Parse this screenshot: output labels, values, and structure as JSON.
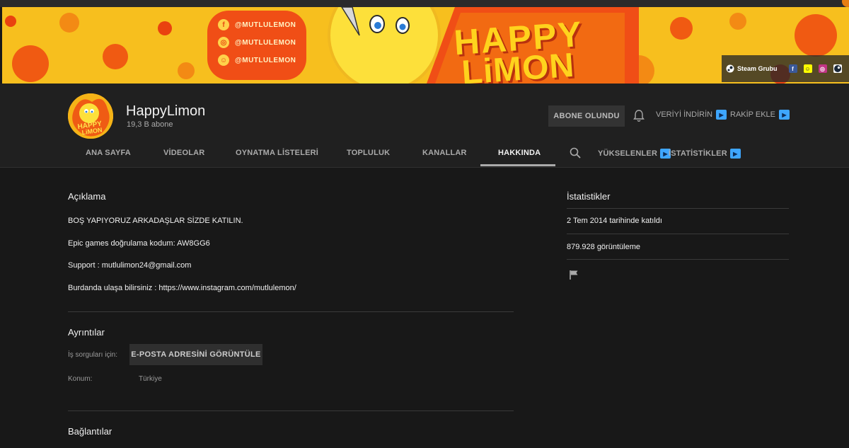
{
  "banner": {
    "social": [
      "@MUTLULEMON",
      "@MUTLULEMON",
      "@MUTLULEMON"
    ],
    "brand_line1": "HAPPY",
    "brand_line2": "LiMON",
    "links": {
      "steam_label": "Steam Grubu",
      "icons": [
        "facebook-icon",
        "snapchat-icon",
        "instagram-icon",
        "steam-icon"
      ]
    }
  },
  "channel": {
    "name": "HappyLimon",
    "subscribers": "19,3 B abone",
    "subscribe_label": "ABONE OLUNDU",
    "ext_download": "VERİYİ İNDİRİN",
    "ext_competitor": "RAKİP EKLE"
  },
  "tabs": [
    {
      "label": "ANA SAYFA"
    },
    {
      "label": "VİDEOLAR"
    },
    {
      "label": "OYNATMA LİSTELERİ"
    },
    {
      "label": "TOPLULUK"
    },
    {
      "label": "KANALLAR"
    },
    {
      "label": "HAKKINDA",
      "active": true
    },
    {
      "label": "YÜKSELENLER"
    },
    {
      "label": "İSTATİSTİKLER"
    }
  ],
  "about": {
    "description_title": "Açıklama",
    "description_lines": [
      "BOŞ YAPIYORUZ ARKADAŞLAR SİZDE KATILIN.",
      "Epic games doğrulama kodum: AW8GG6",
      "Support : mutlulimon24@gmail.com",
      "Burdanda ulaşa bilirsiniz : https://www.instagram.com/mutlulemon/"
    ],
    "details_title": "Ayrıntılar",
    "business_label": "İş sorguları için:",
    "email_button": "E-POSTA ADRESİNİ GÖRÜNTÜLE",
    "location_label": "Konum:",
    "location_value": "Türkiye",
    "links_title": "Bağlantılar"
  },
  "stats": {
    "title": "İstatistikler",
    "joined": "2 Tem 2014 tarihinde katıldı",
    "views": "879.928 görüntüleme"
  },
  "colors": {
    "banner_yellow": "#f7bf1e",
    "banner_orange": "#f04e16",
    "page_bg": "#181818",
    "header_bg": "#202020",
    "ext_blue": "#3ea6ff"
  }
}
